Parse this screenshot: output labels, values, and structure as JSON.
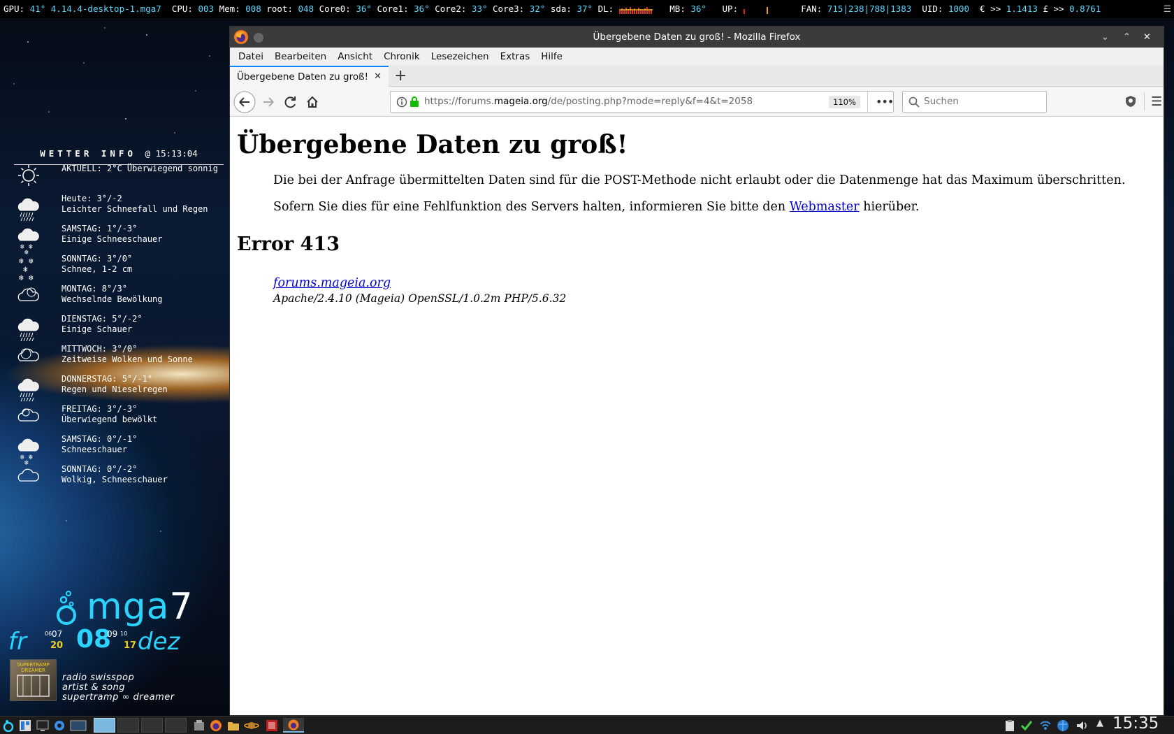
{
  "topbar": {
    "gpu_label": "GPU:",
    "gpu": "41°",
    "kernel": "4.14.4-desktop-1.mga7",
    "cpu_label": "CPU:",
    "cpu": "003",
    "mem_label": "Mem:",
    "mem": "008",
    "root_label": "root:",
    "root": "048",
    "core0_label": "Core0:",
    "core0": "36°",
    "core1_label": "Core1:",
    "core1": "36°",
    "core2_label": "Core2:",
    "core2": "33°",
    "core3_label": "Core3:",
    "core3": "32°",
    "sda_label": "sda:",
    "sda": "37°",
    "dl_label": "DL:",
    "mb_label": "MB:",
    "mb": "36°",
    "up_label": "UP:",
    "fan_label": "FAN:",
    "fan": "715|238|788|1383",
    "uid_label": "UID:",
    "uid": "1000",
    "eur_label": "€ >>",
    "eur": "1.1413",
    "gbp_label": "£ >>",
    "gbp": "0.8761"
  },
  "weather": {
    "title": "WETTER INFO",
    "time": "@ 15:13:04",
    "rows": [
      {
        "l1": "AKTUELL: 2°C  Überwiegend sonnig",
        "l2": "",
        "icon": "sun-icon"
      },
      {
        "l1": "Heute: 3°/-2",
        "l2": "Leichter Schneefall und Regen",
        "icon": "snow-rain-icon"
      },
      {
        "l1": "SAMSTAG: 1°/-3°",
        "l2": "Einige Schneeschauer",
        "icon": "snow-showers-icon"
      },
      {
        "l1": "SONNTAG: 3°/0°",
        "l2": "Schnee, 1-2 cm",
        "icon": "snow-icon"
      },
      {
        "l1": "MONTAG: 8°/3°",
        "l2": "Wechselnde Bewölkung",
        "icon": "partly-cloudy-icon"
      },
      {
        "l1": "DIENSTAG: 5°/-2°",
        "l2": "Einige Schauer",
        "icon": "showers-icon"
      },
      {
        "l1": "MITTWOCH: 3°/0°",
        "l2": "Zeitweise Wolken und Sonne",
        "icon": "sun-cloud-icon"
      },
      {
        "l1": "DONNERSTAG: 5°/-1°",
        "l2": "Regen und Nieselregen",
        "icon": "rain-icon"
      },
      {
        "l1": "FREITAG: 3°/-3°",
        "l2": "Überwiegend bewölkt",
        "icon": "mostly-cloudy-icon"
      },
      {
        "l1": "SAMSTAG: 0°/-1°",
        "l2": "Schneeschauer",
        "icon": "snow-showers-icon"
      },
      {
        "l1": "SONNTAG: 0°/-2°",
        "l2": "Wolkig, Schneeschauer",
        "icon": "cloud-icon"
      }
    ]
  },
  "distro": {
    "logo_text": "mga",
    "logo_num": "7"
  },
  "date": {
    "day": "fr",
    "d1": "06",
    "d2": "07",
    "day_big": "08",
    "d3": "09",
    "d4": "10",
    "year_a": "20",
    "year_b": "17",
    "month": "dez"
  },
  "music": {
    "album_text": "SUPERTRAMP DREAMER",
    "l1": "radio swisspop",
    "l2": "artist & song",
    "l3": "supertramp ∞ dreamer"
  },
  "firefox": {
    "title": "Übergebene Daten zu groß! - Mozilla Firefox",
    "menu": [
      "Datei",
      "Bearbeiten",
      "Ansicht",
      "Chronik",
      "Lesezeichen",
      "Extras",
      "Hilfe"
    ],
    "tab_title": "Übergebene Daten zu groß!",
    "url_prefix": "https://forums.",
    "url_domain": "mageia.org",
    "url_path": "/de/posting.php?mode=reply&f=4&t=2058",
    "zoom": "110%",
    "search_placeholder": "Suchen"
  },
  "page": {
    "h1": "Übergebene Daten zu groß!",
    "p1": "Die bei der Anfrage übermittelten Daten sind für die POST-Methode nicht erlaubt oder die Datenmenge hat das Maximum überschritten.",
    "p2_a": "Sofern Sie dies für eine Fehlfunktion des Servers halten, informieren Sie bitte den",
    "p2_link": "Webmaster",
    "p2_b": "hierüber.",
    "h2": "Error 413",
    "addr_link": "forums.mageia.org",
    "addr_server": "Apache/2.4.10 (Mageia) OpenSSL/1.0.2m PHP/5.6.32"
  },
  "taskbar": {
    "clock": "15:35"
  }
}
